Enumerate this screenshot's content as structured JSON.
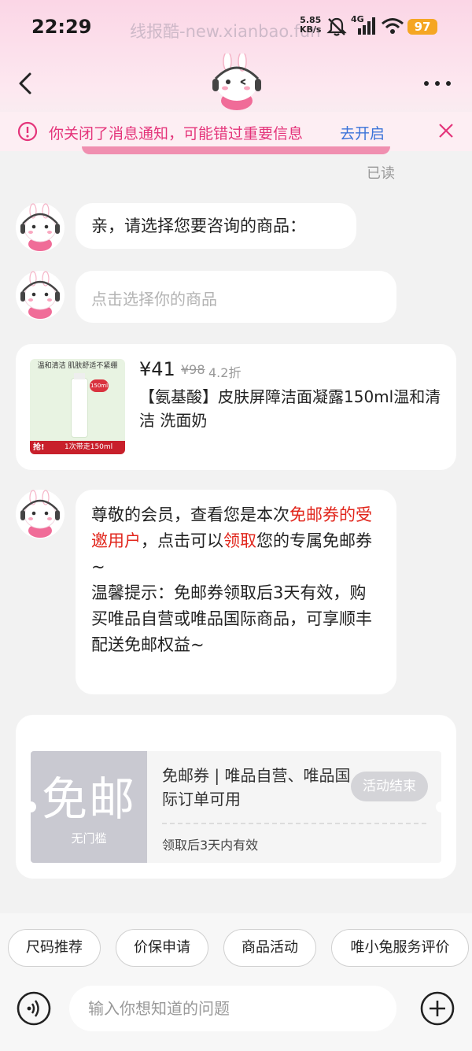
{
  "status_bar": {
    "time": "22:29",
    "watermark": "线报酷-new.xianbao.fun",
    "net_speed_value": "5.85",
    "net_speed_unit": "KB/s",
    "network": "4G",
    "battery": "97"
  },
  "notice": {
    "text": "你关闭了消息通知，可能错过重要信息",
    "link": "去开启"
  },
  "read_label": "已读",
  "messages": {
    "greeting": "亲，请选择您要咨询的商品：",
    "select_placeholder": "点击选择你的商品"
  },
  "product": {
    "price": "¥41",
    "old_price": "¥98",
    "discount": "4.2折",
    "title": "【氨基酸】皮肤屏障洁面凝露150ml温和清洁 洗面奶",
    "img_banner": "温和清洁 肌肤舒适不紧绷",
    "img_tag": "抢!",
    "img_caption": "1次带走150ml",
    "img_badge": "150ml"
  },
  "member_message": {
    "p1_a": "尊敬的会员，查看您是本次",
    "p1_red1": "免邮券的受邀用户",
    "p1_b": "，点击可以",
    "p1_red2": "领取",
    "p1_c": "您的专属免邮券~",
    "p2": "温馨提示：免邮券领取后3天有效，购买唯品自营或唯品国际商品，可享顺丰配送免邮权益~"
  },
  "coupon": {
    "big_text": "免邮",
    "small_text": "无门槛",
    "title": "免邮券 | 唯品自营、唯品国际订单可用",
    "validity": "领取后3天内有效",
    "status": "活动结束"
  },
  "quick_actions": [
    "尺码推荐",
    "价保申请",
    "商品活动",
    "唯小兔服务评价"
  ],
  "input": {
    "placeholder": "输入你想知道的问题"
  },
  "colors": {
    "accent_pink": "#e4347a",
    "link_blue": "#3a73d9",
    "highlight_red": "#e1251b"
  }
}
